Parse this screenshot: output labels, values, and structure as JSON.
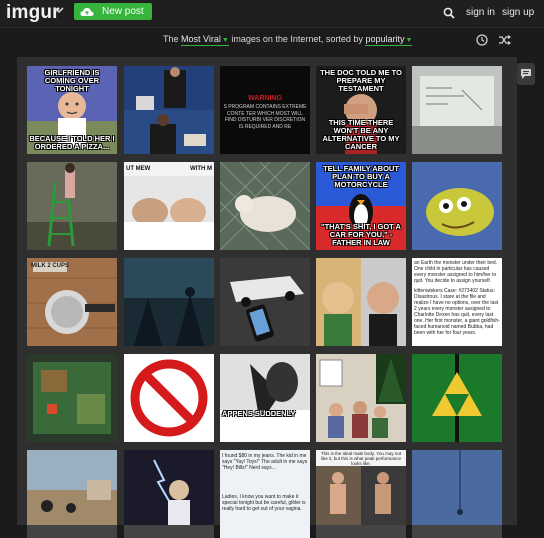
{
  "header": {
    "logo": "imgur",
    "new_post_label": "New post",
    "sign_in_label": "sign in",
    "sign_up_label": "sign up"
  },
  "subheader": {
    "prefix": "The",
    "sort_section": "Most Viral",
    "middle": "images on the Internet, sorted by",
    "sort_mode": "popularity"
  },
  "colors": {
    "accent_green": "#36b43b",
    "background": "#1b1b1b"
  },
  "icons": [
    "search-icon",
    "cloud-upload-icon",
    "chevron-down-icon",
    "clock-icon",
    "shuffle-icon",
    "chat-icon"
  ],
  "tiles": [
    {
      "row": 1,
      "col": 1,
      "top_text": "GIRLFRIEND IS COMING OVER TONIGHT",
      "bottom_text": "BECAUSE I TOLD HER I ORDERED A PIZZA..."
    },
    {
      "row": 1,
      "col": 2,
      "top_text": "",
      "bottom_text": ""
    },
    {
      "row": 1,
      "col": 3,
      "top_text": "WARNING",
      "bottom_text": "S PROGRAM CONTAINS EXTREME CONTE TER WHICH MOST WILL FIND DISTURBI VER DISCRETION IS REQUIRED AND RE"
    },
    {
      "row": 1,
      "col": 4,
      "top_text": "THE DOC TOLD ME TO PREPARE MY TESTAMENT",
      "bottom_text": "THIS TIME THERE WON'T BE ANY ALTERNATIVE TO MY CANCER"
    },
    {
      "row": 1,
      "col": 5,
      "top_text": "",
      "bottom_text": ""
    },
    {
      "row": 2,
      "col": 1,
      "top_text": "",
      "bottom_text": ""
    },
    {
      "row": 2,
      "col": 2,
      "top_text": "UT MEW",
      "bottom_text": "WITH M"
    },
    {
      "row": 2,
      "col": 3,
      "top_text": "",
      "bottom_text": ""
    },
    {
      "row": 2,
      "col": 4,
      "top_text": "TELL FAMILY ABOUT PLAN TO BUY A MOTORCYCLE",
      "bottom_text": "\"THAT'S SHIT, I GOT A CAR FOR YOU.\" -FATHER IN LAW"
    },
    {
      "row": 2,
      "col": 5,
      "top_text": "",
      "bottom_text": ""
    },
    {
      "row": 3,
      "col": 1,
      "top_text": "MILK",
      "bottom_text": "2 CUPS"
    },
    {
      "row": 3,
      "col": 2,
      "top_text": "",
      "bottom_text": ""
    },
    {
      "row": 3,
      "col": 3,
      "top_text": "",
      "bottom_text": ""
    },
    {
      "row": 3,
      "col": 4,
      "top_text": "",
      "bottom_text": ""
    },
    {
      "row": 3,
      "col": 5,
      "top_text": "an Earth the monster under their bed. One child in particular has caused every monster assigned to him/her to quit. You decide to assign yourself.",
      "bottom_text": "kittenwiskers  Case: #273402  Status: Disastrous.  I stare at the file and realize I have no options, over the last 2 years every monster assigned to Charlotte Dexen has quit, every last one. Her first monster, a giant goldfish-faced humanoid named Bubba, had been with her for four years."
    },
    {
      "row": 4,
      "col": 1,
      "top_text": "",
      "bottom_text": ""
    },
    {
      "row": 4,
      "col": 2,
      "top_text": "",
      "bottom_text": ""
    },
    {
      "row": 4,
      "col": 3,
      "top_text": "",
      "bottom_text": "APPENS SUDDENLY"
    },
    {
      "row": 4,
      "col": 4,
      "top_text": "",
      "bottom_text": ""
    },
    {
      "row": 4,
      "col": 5,
      "top_text": "",
      "bottom_text": ""
    },
    {
      "row": 5,
      "col": 1,
      "top_text": "",
      "bottom_text": ""
    },
    {
      "row": 5,
      "col": 2,
      "top_text": "",
      "bottom_text": ""
    },
    {
      "row": 5,
      "col": 3,
      "top_text": "I found $80 in my jeans. The kid in me says \"Yay! Toys!\" The adult in me says \"Hey! Bills!\" Nerd says...",
      "bottom_text": "Ladies, I know you want to make it special tonight but be careful, glitter is really hard to get out of your vagina."
    },
    {
      "row": 5,
      "col": 4,
      "top_text": "This is the ideal male body. You may not like it, but this is what peak performance looks like.",
      "bottom_text": ""
    },
    {
      "row": 5,
      "col": 5,
      "top_text": "",
      "bottom_text": ""
    }
  ]
}
